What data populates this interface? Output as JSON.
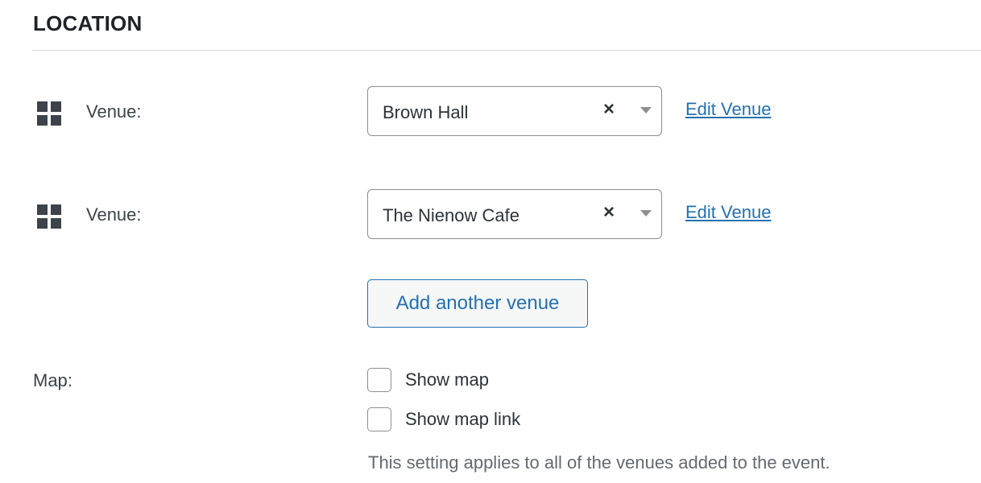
{
  "section": {
    "title": "LOCATION"
  },
  "venues": [
    {
      "label": "Venue:",
      "selected": "Brown Hall",
      "clear_icon": "×",
      "edit_label": "Edit Venue"
    },
    {
      "label": "Venue:",
      "selected": "The Nienow Cafe",
      "clear_icon": "×",
      "edit_label": "Edit Venue"
    }
  ],
  "add_venue_label": "Add another venue",
  "map": {
    "label": "Map:",
    "options": [
      {
        "label": "Show map",
        "checked": false
      },
      {
        "label": "Show map link",
        "checked": false
      }
    ],
    "help_text": "This setting applies to all of the venues added to the event."
  },
  "icons": {
    "drag_handle": "drag-handle-grid-icon",
    "clear": "clear-x-icon",
    "dropdown": "chevron-down-icon"
  },
  "colors": {
    "link": "#2271b1",
    "text": "#3c434a",
    "border": "#8c8f94",
    "divider": "#dcdcde"
  }
}
